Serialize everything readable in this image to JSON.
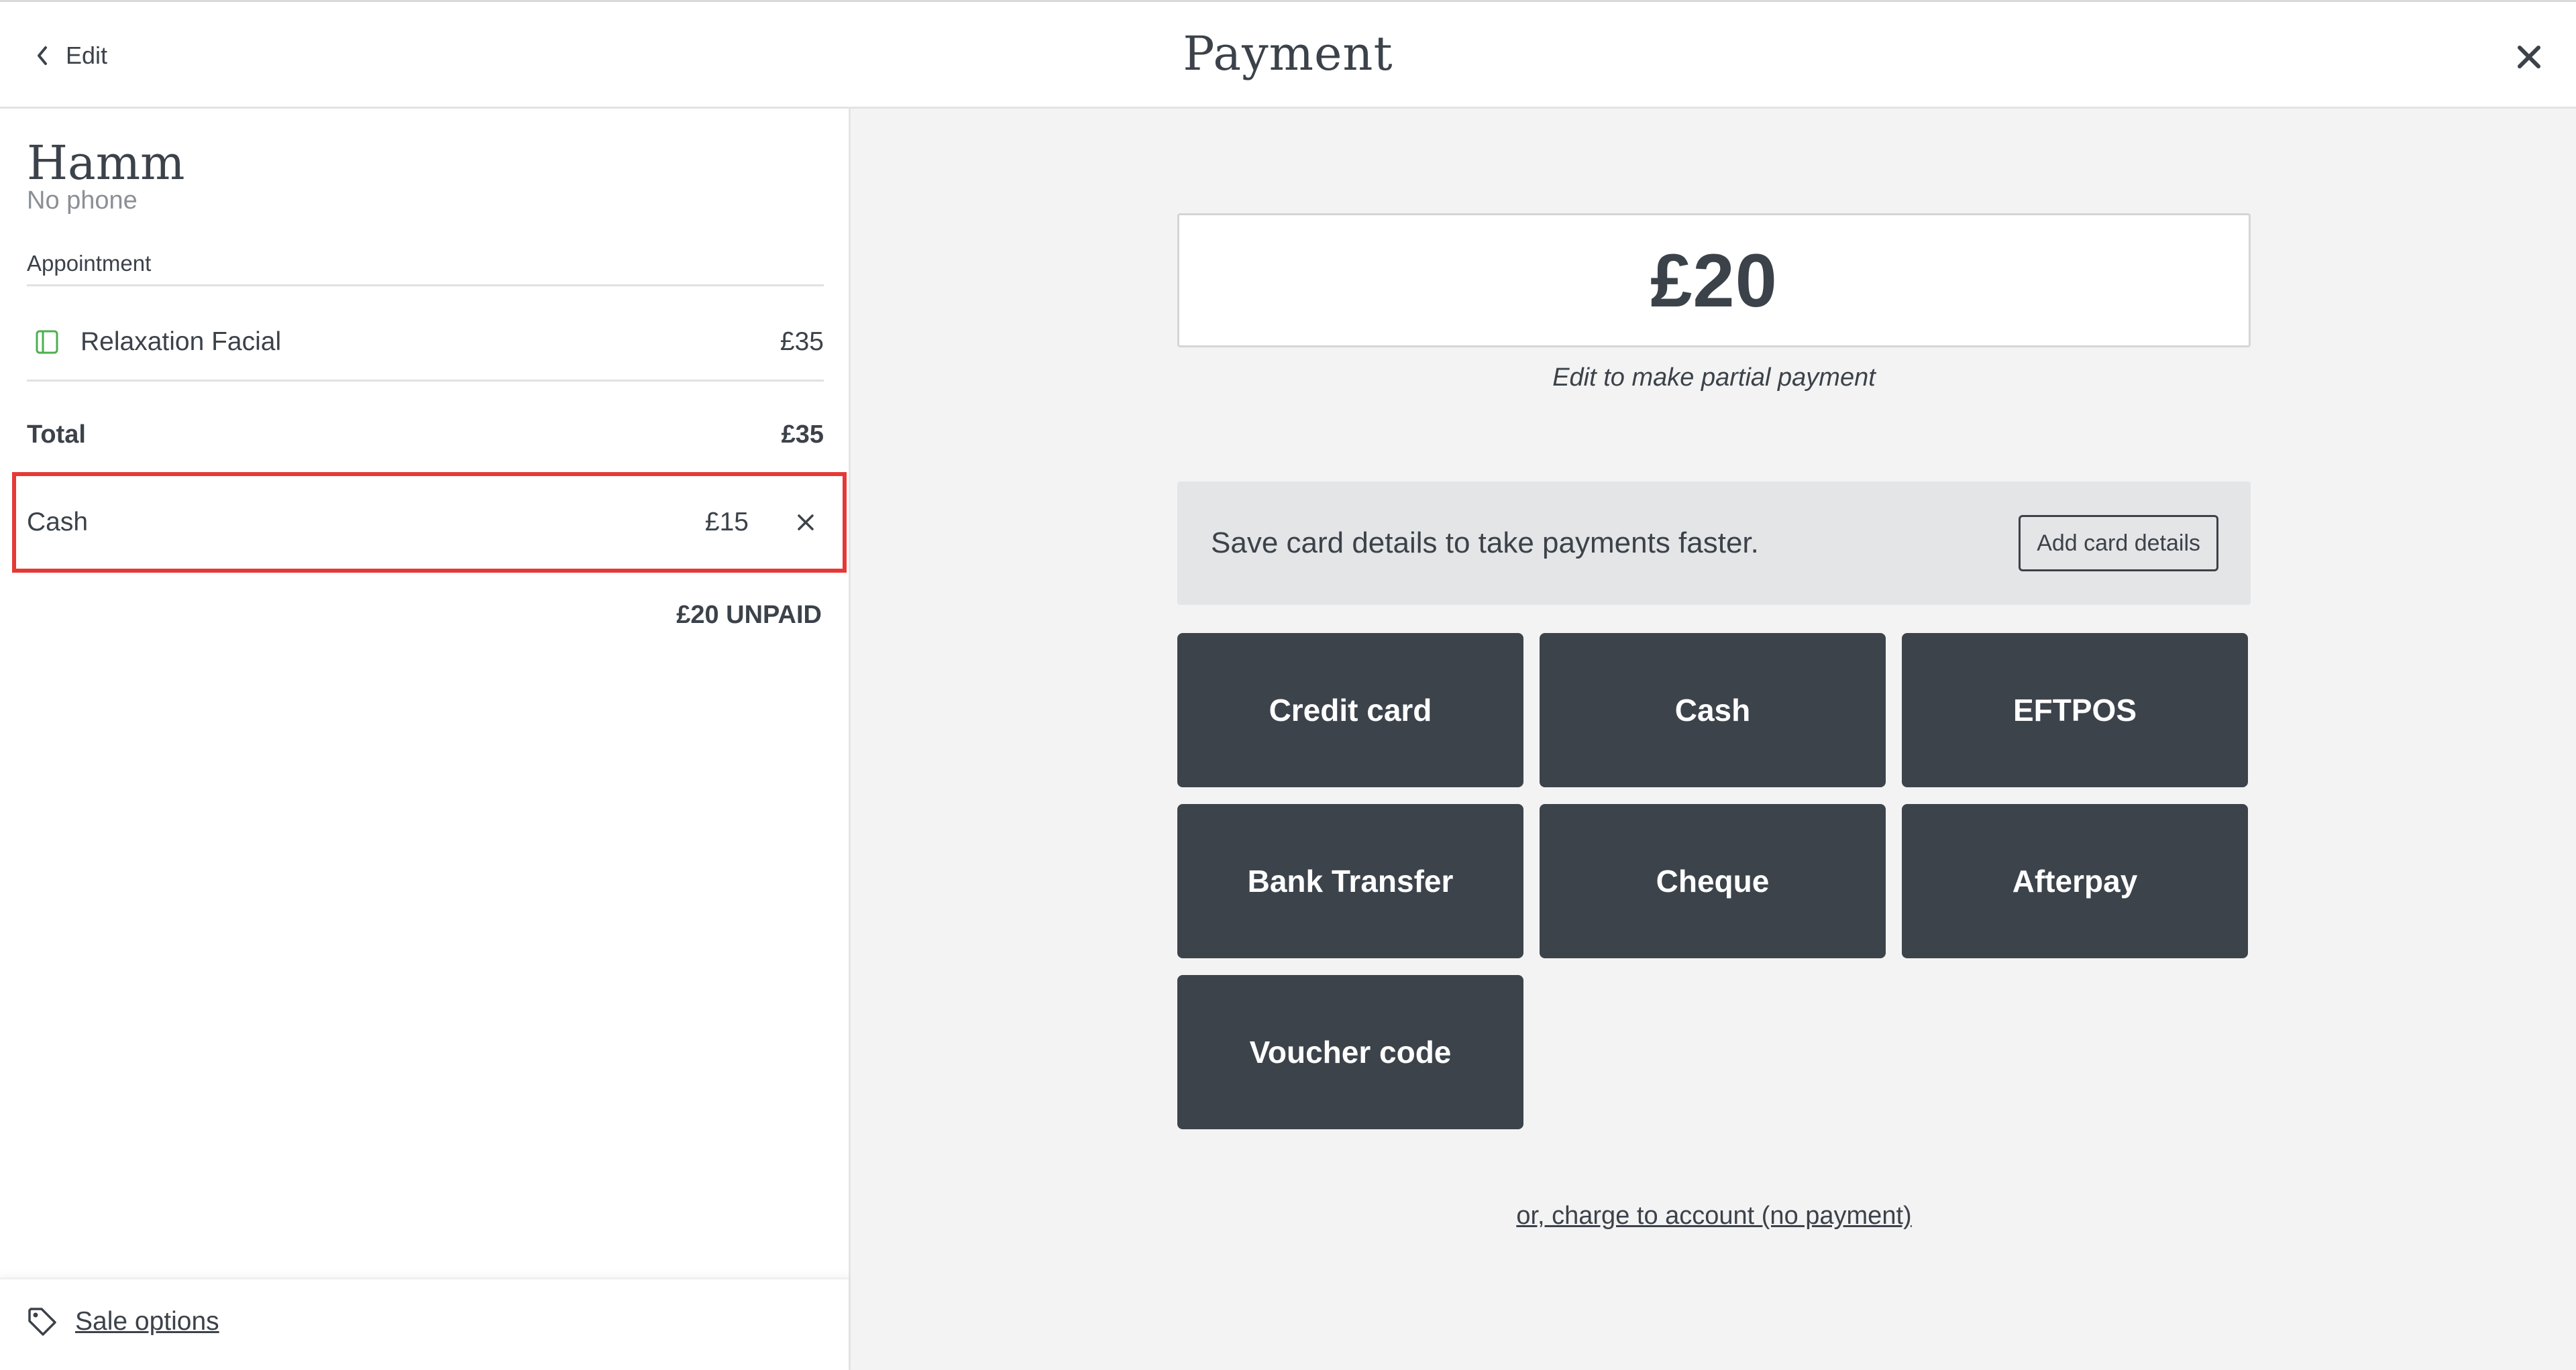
{
  "header": {
    "back_label": "Edit",
    "title": "Payment"
  },
  "client": {
    "name": "Hamm",
    "phone": "No phone"
  },
  "appointment": {
    "section_label": "Appointment",
    "service_name": "Relaxation Facial",
    "service_price": "£35",
    "service_icon_color": "#4caf50"
  },
  "totals": {
    "total_label": "Total",
    "total_value": "£35"
  },
  "payment_line": {
    "method": "Cash",
    "amount": "£15"
  },
  "unpaid_label": "£20 UNPAID",
  "footer": {
    "sale_options_label": "Sale options"
  },
  "amount": {
    "value": "£20",
    "hint": "Edit to make partial payment"
  },
  "card_banner": {
    "text": "Save card details to take payments faster.",
    "button_label": "Add card details"
  },
  "methods": [
    "Credit card",
    "Cash",
    "EFTPOS",
    "Bank Transfer",
    "Cheque",
    "Afterpay",
    "Voucher code"
  ],
  "charge_link": "or, charge to account (no payment)",
  "colors": {
    "highlight_border": "#e53935",
    "button_bg": "#3c434b",
    "panel_bg": "#f3f3f3"
  },
  "icons": {
    "back": "chevron-left-icon",
    "close": "close-icon",
    "service": "service-card-icon",
    "remove": "remove-x-icon",
    "sale_options": "tag-icon"
  }
}
